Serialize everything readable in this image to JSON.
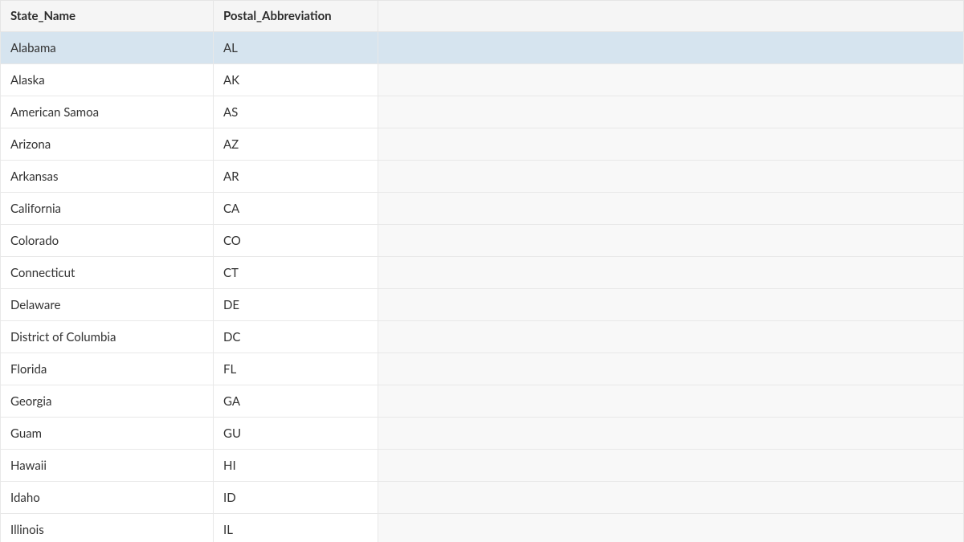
{
  "table": {
    "columns": [
      {
        "key": "state_name",
        "label": "State_Name"
      },
      {
        "key": "postal_abbreviation",
        "label": "Postal_Abbreviation"
      }
    ],
    "rows": [
      {
        "state_name": "Alabama",
        "postal_abbreviation": "AL",
        "selected": true
      },
      {
        "state_name": "Alaska",
        "postal_abbreviation": "AK",
        "selected": false
      },
      {
        "state_name": "American Samoa",
        "postal_abbreviation": "AS",
        "selected": false
      },
      {
        "state_name": "Arizona",
        "postal_abbreviation": "AZ",
        "selected": false
      },
      {
        "state_name": "Arkansas",
        "postal_abbreviation": "AR",
        "selected": false
      },
      {
        "state_name": "California",
        "postal_abbreviation": "CA",
        "selected": false
      },
      {
        "state_name": "Colorado",
        "postal_abbreviation": "CO",
        "selected": false
      },
      {
        "state_name": "Connecticut",
        "postal_abbreviation": "CT",
        "selected": false
      },
      {
        "state_name": "Delaware",
        "postal_abbreviation": "DE",
        "selected": false
      },
      {
        "state_name": "District of Columbia",
        "postal_abbreviation": "DC",
        "selected": false
      },
      {
        "state_name": "Florida",
        "postal_abbreviation": "FL",
        "selected": false
      },
      {
        "state_name": "Georgia",
        "postal_abbreviation": "GA",
        "selected": false
      },
      {
        "state_name": "Guam",
        "postal_abbreviation": "GU",
        "selected": false
      },
      {
        "state_name": "Hawaii",
        "postal_abbreviation": "HI",
        "selected": false
      },
      {
        "state_name": "Idaho",
        "postal_abbreviation": "ID",
        "selected": false
      },
      {
        "state_name": "Illinois",
        "postal_abbreviation": "IL",
        "selected": false
      }
    ]
  }
}
